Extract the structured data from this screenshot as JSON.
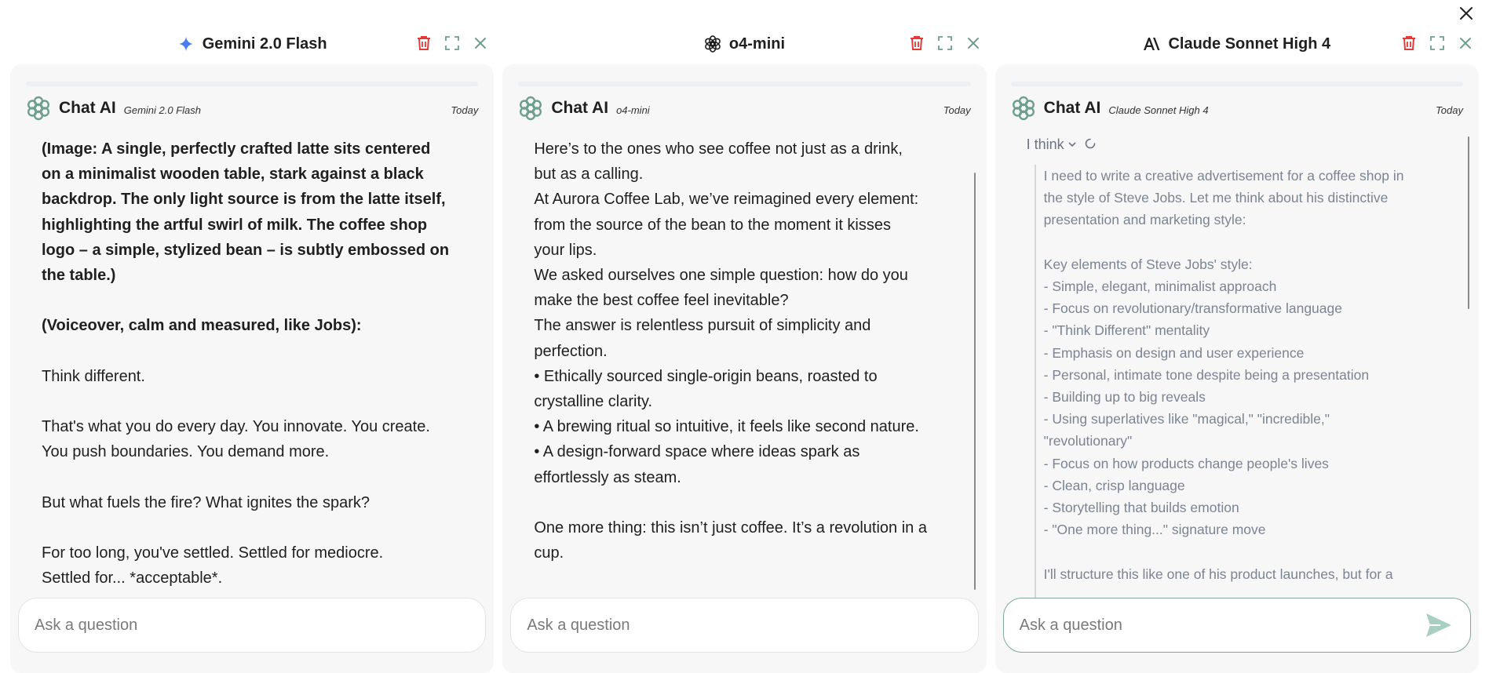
{
  "panels": [
    {
      "model_title": "Gemini 2.0 Flash",
      "model_icon": "gemini-sparkle-icon",
      "chat_name": "Chat AI",
      "model_tag": "Gemini 2.0 Flash",
      "date": "Today",
      "paragraphs": [
        {
          "bold": true,
          "text": "(Image: A single, perfectly crafted latte sits centered\non a minimalist wooden table, stark against a black\nbackdrop. The only light source is from the latte itself,\nhighlighting the artful swirl of milk. The coffee shop\nlogo – a simple, stylized bean – is subtly embossed on\nthe table.)"
        },
        {
          "bold": true,
          "text": "(Voiceover, calm and measured, like Jobs):"
        },
        {
          "bold": false,
          "text": "Think different."
        },
        {
          "bold": false,
          "text": "That's what you do every day. You innovate. You create.\nYou push boundaries. You demand more."
        },
        {
          "bold": false,
          "text": "But what fuels the fire? What ignites the spark?"
        },
        {
          "bold": false,
          "text": "For too long, you've settled. Settled for mediocre.\nSettled for... *acceptable*."
        }
      ],
      "ask_placeholder": "Ask a question"
    },
    {
      "model_title": "o4-mini",
      "model_icon": "openai-logo-icon",
      "chat_name": "Chat AI",
      "model_tag": "o4-mini",
      "date": "Today",
      "lines": [
        "Here’s to the ones who see coffee not just as a drink,",
        "but as a calling.",
        "At Aurora Coffee Lab, we’ve reimagined every element:",
        "from the source of the bean to the moment it kisses",
        "your lips.",
        "We asked ourselves one simple question: how do you",
        "make the best coffee feel inevitable?",
        "The answer is relentless pursuit of simplicity and",
        "perfection.",
        "• Ethically sourced single-origin beans, roasted to",
        "crystalline clarity.",
        "• A brewing ritual so intuitive, it feels like second nature.",
        "• A design-forward space where ideas spark as",
        "effortlessly as steam.",
        "",
        "One more thing: this isn’t just coffee. It’s a revolution in a",
        "cup."
      ],
      "ask_placeholder": "Ask a question"
    },
    {
      "model_title": "Claude Sonnet High 4",
      "model_icon": "anthropic-logo-icon",
      "chat_name": "Chat AI",
      "model_tag": "Claude Sonnet High 4",
      "date": "Today",
      "think_label": "I think",
      "think_lines": [
        "I need to write a creative advertisement for a coffee shop in",
        "the style of Steve Jobs. Let me think about his distinctive",
        "presentation and marketing style:",
        "",
        "Key elements of Steve Jobs' style:",
        "- Simple, elegant, minimalist approach",
        "- Focus on revolutionary/transformative language",
        "- \"Think Different\" mentality",
        "- Emphasis on design and user experience",
        "- Personal, intimate tone despite being a presentation",
        "- Building up to big reveals",
        "- Using superlatives like \"magical,\" \"incredible,\"",
        "\"revolutionary\"",
        "- Focus on how products change people's lives",
        "- Clean, crisp language",
        "- Storytelling that builds emotion",
        "- \"One more thing...\" signature move",
        "",
        "I'll structure this like one of his product launches, but for a"
      ],
      "ask_placeholder": "Ask a question"
    }
  ],
  "colors": {
    "delete_icon": "#e53935",
    "panel_bg": "#f7f7f7",
    "accent": "#6e9f8e"
  }
}
